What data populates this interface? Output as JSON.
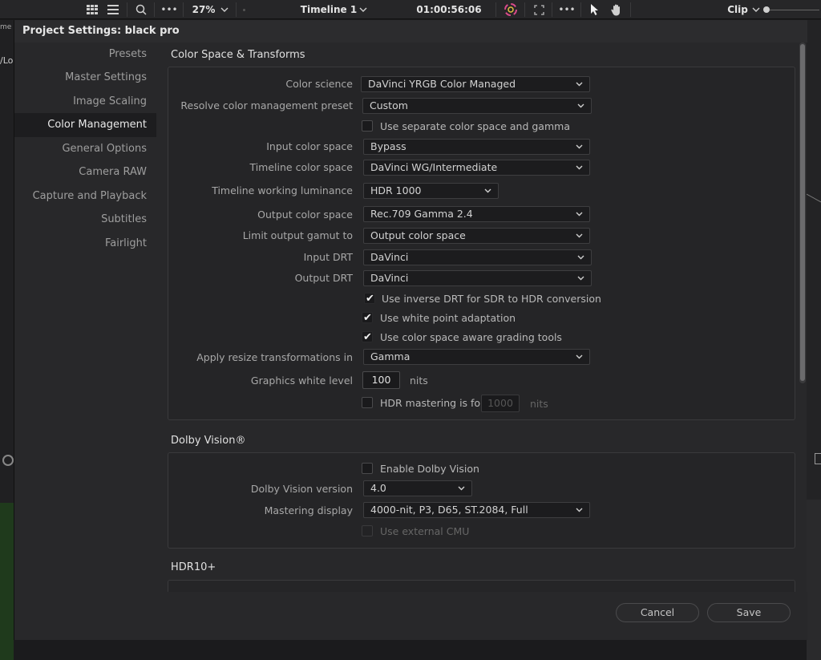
{
  "toolbar": {
    "zoom": "27%",
    "timeline_name": "Timeline 1",
    "timecode": "01:00:56:06",
    "clip_label": "Clip"
  },
  "background": {
    "cut_text_1": "me",
    "cut_text_2": "/Lo"
  },
  "dialog": {
    "title": "Project Settings:  black pro",
    "sidebar": [
      {
        "label": "Presets",
        "active": false
      },
      {
        "label": "Master Settings",
        "active": false
      },
      {
        "label": "Image Scaling",
        "active": false
      },
      {
        "label": "Color Management",
        "active": true
      },
      {
        "label": "General Options",
        "active": false
      },
      {
        "label": "Camera RAW",
        "active": false
      },
      {
        "label": "Capture and Playback",
        "active": false
      },
      {
        "label": "Subtitles",
        "active": false
      },
      {
        "label": "Fairlight",
        "active": false
      }
    ],
    "color_space": {
      "section_title": "Color Space & Transforms",
      "color_science_label": "Color science",
      "color_science_value": "DaVinci YRGB Color Managed",
      "preset_label": "Resolve color management preset",
      "preset_value": "Custom",
      "separate_gamma_label": "Use separate color space and gamma",
      "separate_gamma_checked": false,
      "input_cs_label": "Input color space",
      "input_cs_value": "Bypass",
      "timeline_cs_label": "Timeline color space",
      "timeline_cs_value": "DaVinci WG/Intermediate",
      "working_lum_label": "Timeline working luminance",
      "working_lum_value": "HDR 1000",
      "output_cs_label": "Output color space",
      "output_cs_value": "Rec.709 Gamma 2.4",
      "limit_gamut_label": "Limit output gamut to",
      "limit_gamut_value": "Output color space",
      "input_drt_label": "Input DRT",
      "input_drt_value": "DaVinci",
      "output_drt_label": "Output DRT",
      "output_drt_value": "DaVinci",
      "inverse_drt_label": "Use inverse DRT for SDR to HDR conversion",
      "inverse_drt_checked": true,
      "white_point_label": "Use white point adaptation",
      "white_point_checked": true,
      "aware_tools_label": "Use color space aware grading tools",
      "aware_tools_checked": true,
      "resize_label": "Apply resize transformations in",
      "resize_value": "Gamma",
      "graphics_white_label": "Graphics white level",
      "graphics_white_value": "100",
      "graphics_white_unit": "nits",
      "hdr_mastering_label": "HDR mastering is for",
      "hdr_mastering_checked": false,
      "hdr_mastering_value": "1000",
      "hdr_mastering_unit": "nits"
    },
    "dolby": {
      "section_title": "Dolby Vision®",
      "enable_label": "Enable Dolby Vision",
      "enable_checked": false,
      "version_label": "Dolby Vision version",
      "version_value": "4.0",
      "mastering_label": "Mastering display",
      "mastering_value": "4000-nit, P3, D65, ST.2084, Full",
      "external_cmu_label": "Use external CMU",
      "external_cmu_checked": false
    },
    "hdr10": {
      "section_title": "HDR10+"
    },
    "buttons": {
      "cancel": "Cancel",
      "save": "Save"
    }
  }
}
